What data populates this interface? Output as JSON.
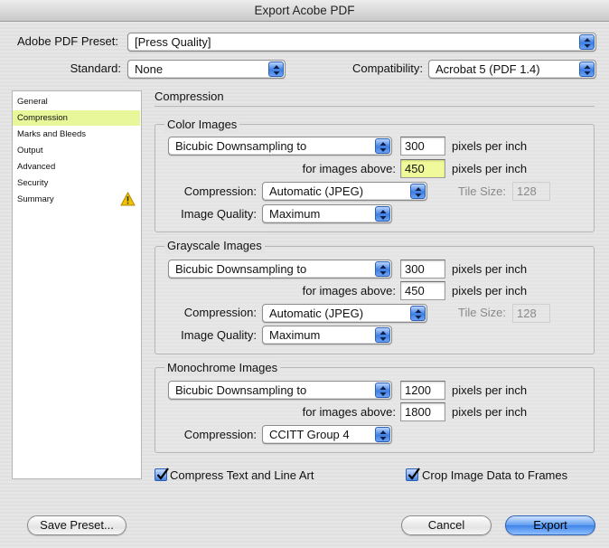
{
  "window": {
    "title": "Export Acobe PDF"
  },
  "preset": {
    "label": "Adobe PDF Preset:",
    "value": "[Press Quality]"
  },
  "standard": {
    "label": "Standard:",
    "value": "None"
  },
  "compatibility": {
    "label": "Compatibility:",
    "value": "Acrobat 5 (PDF 1.4)"
  },
  "sidebar": {
    "items": [
      {
        "label": "General"
      },
      {
        "label": "Compression"
      },
      {
        "label": "Marks and Bleeds"
      },
      {
        "label": "Output"
      },
      {
        "label": "Advanced"
      },
      {
        "label": "Security"
      },
      {
        "label": "Summary"
      }
    ],
    "selected": "Compression"
  },
  "section": {
    "title": "Compression"
  },
  "color": {
    "title": "Color Images",
    "downsampling": "Bicubic Downsampling to",
    "ppi": "300",
    "ppi_unit": "pixels per inch",
    "above_label": "for images above:",
    "above": "450",
    "above_unit": "pixels per inch",
    "compression_label": "Compression:",
    "compression": "Automatic (JPEG)",
    "tile_label": "Tile Size:",
    "tile": "128",
    "quality_label": "Image Quality:",
    "quality": "Maximum"
  },
  "gray": {
    "title": "Grayscale Images",
    "downsampling": "Bicubic Downsampling to",
    "ppi": "300",
    "ppi_unit": "pixels per inch",
    "above_label": "for images above:",
    "above": "450",
    "above_unit": "pixels per inch",
    "compression_label": "Compression:",
    "compression": "Automatic (JPEG)",
    "tile_label": "Tile Size:",
    "tile": "128",
    "quality_label": "Image Quality:",
    "quality": "Maximum"
  },
  "mono": {
    "title": "Monochrome Images",
    "downsampling": "Bicubic Downsampling to",
    "ppi": "1200",
    "ppi_unit": "pixels per inch",
    "above_label": "for images above:",
    "above": "1800",
    "above_unit": "pixels per inch",
    "compression_label": "Compression:",
    "compression": "CCITT Group 4"
  },
  "options": {
    "compress_text": "Compress Text and Line Art",
    "crop_image": "Crop Image Data to Frames"
  },
  "buttons": {
    "save_preset": "Save Preset...",
    "cancel": "Cancel",
    "export": "Export"
  },
  "colors": {
    "accent": "#3f83e8",
    "selection": "#e8f79a",
    "highlight_field": "#f1fa9a",
    "warning": "#f2c200"
  }
}
